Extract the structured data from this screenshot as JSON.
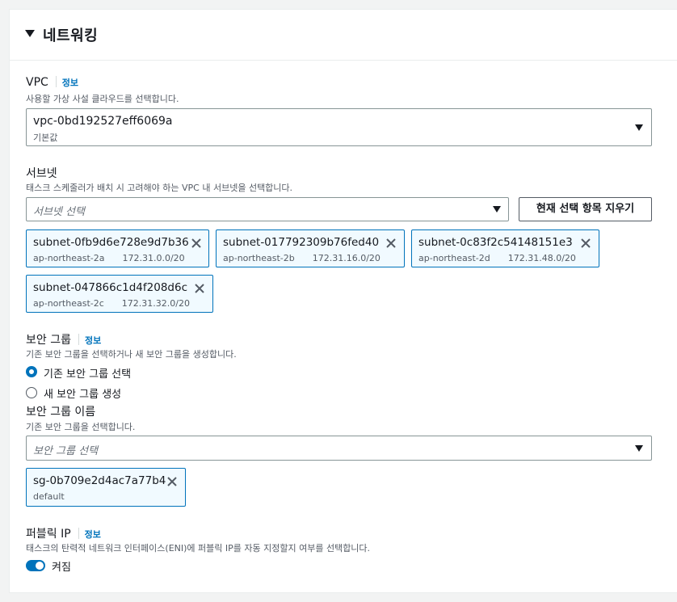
{
  "section": {
    "title": "네트워킹"
  },
  "vpc": {
    "label": "VPC",
    "info": "정보",
    "description": "사용할 가상 사설 클라우드를 선택합니다.",
    "selected_value": "vpc-0bd192527eff6069a",
    "selected_subtext": "기본값"
  },
  "subnets": {
    "label": "서브넷",
    "description": "태스크 스케줄러가 배치 시 고려해야 하는 VPC 내 서브넷을 선택합니다.",
    "placeholder": "서브넷 선택",
    "clear_button": "현재 선택 항목 지우기",
    "tokens": [
      {
        "id": "subnet-0fb9d6e728e9d7b36",
        "az": "ap-northeast-2a",
        "cidr": "172.31.0.0/20"
      },
      {
        "id": "subnet-017792309b76fed40",
        "az": "ap-northeast-2b",
        "cidr": "172.31.16.0/20"
      },
      {
        "id": "subnet-0c83f2c54148151e3",
        "az": "ap-northeast-2d",
        "cidr": "172.31.48.0/20"
      },
      {
        "id": "subnet-047866c1d4f208d6c",
        "az": "ap-northeast-2c",
        "cidr": "172.31.32.0/20"
      }
    ]
  },
  "security_group": {
    "label": "보안 그룹",
    "info": "정보",
    "description": "기존 보안 그룹을 선택하거나 새 보안 그룹을 생성합니다.",
    "option_existing": "기존 보안 그룹 선택",
    "option_new": "새 보안 그룹 생성",
    "name_label": "보안 그룹 이름",
    "name_description": "기존 보안 그룹을 선택합니다.",
    "placeholder": "보안 그룹 선택",
    "token": {
      "id": "sg-0b709e2d4ac7a77b4",
      "name": "default"
    }
  },
  "public_ip": {
    "label": "퍼블릭 IP",
    "info": "정보",
    "description": "태스크의 탄력적 네트워크 인터페이스(ENI)에 퍼블릭 IP를 자동 지정할지 여부를 선택합니다.",
    "toggle_label": "켜짐"
  },
  "colors": {
    "accent": "#0073bb",
    "token_bg": "#f1faff"
  }
}
